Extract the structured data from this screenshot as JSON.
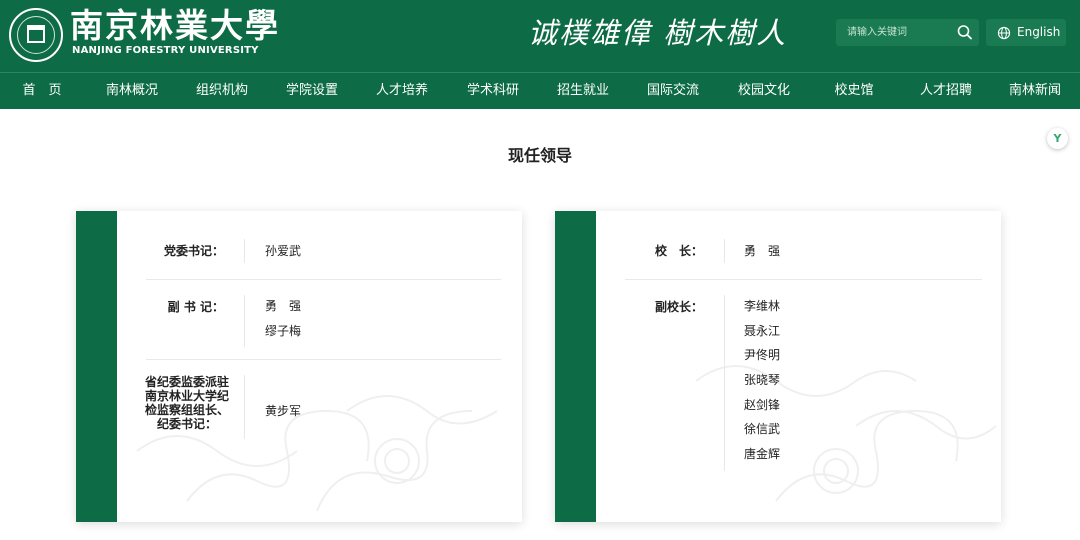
{
  "header": {
    "logo_cn": "南京林業大學",
    "logo_en": "NANJING FORESTRY UNIVERSITY",
    "motto": "诚樸雄偉 樹木樹人",
    "search_placeholder": "请输入关键词",
    "lang_label": "English"
  },
  "nav": {
    "items": [
      "首　页",
      "南林概况",
      "组织机构",
      "学院设置",
      "人才培养",
      "学术科研",
      "招生就业",
      "国际交流",
      "校园文化",
      "校史馆",
      "人才招聘",
      "南林新闻"
    ]
  },
  "page": {
    "title": "现任领导",
    "badge": "Y"
  },
  "cards": {
    "left": {
      "rows": [
        {
          "role": "党委书记：",
          "names": [
            "孙爱武"
          ]
        },
        {
          "role": "副 书 记：",
          "names": [
            "勇　强",
            "缪子梅"
          ]
        },
        {
          "role": "省纪委监委派驻南京林业大学纪检监察组组长、纪委书记：",
          "names": [
            "黄步军"
          ]
        }
      ]
    },
    "right": {
      "rows": [
        {
          "role": "校　长：",
          "names": [
            "勇　强"
          ]
        },
        {
          "role": "副校长：",
          "names": [
            "李维林",
            "聂永江",
            "尹佟明",
            "张晓琴",
            "赵剑锋",
            "徐信武",
            "唐金辉"
          ]
        }
      ]
    }
  },
  "colors": {
    "brand_green": "#0d6b45",
    "header_control": "#1a7a52",
    "text_dark": "#222222"
  }
}
